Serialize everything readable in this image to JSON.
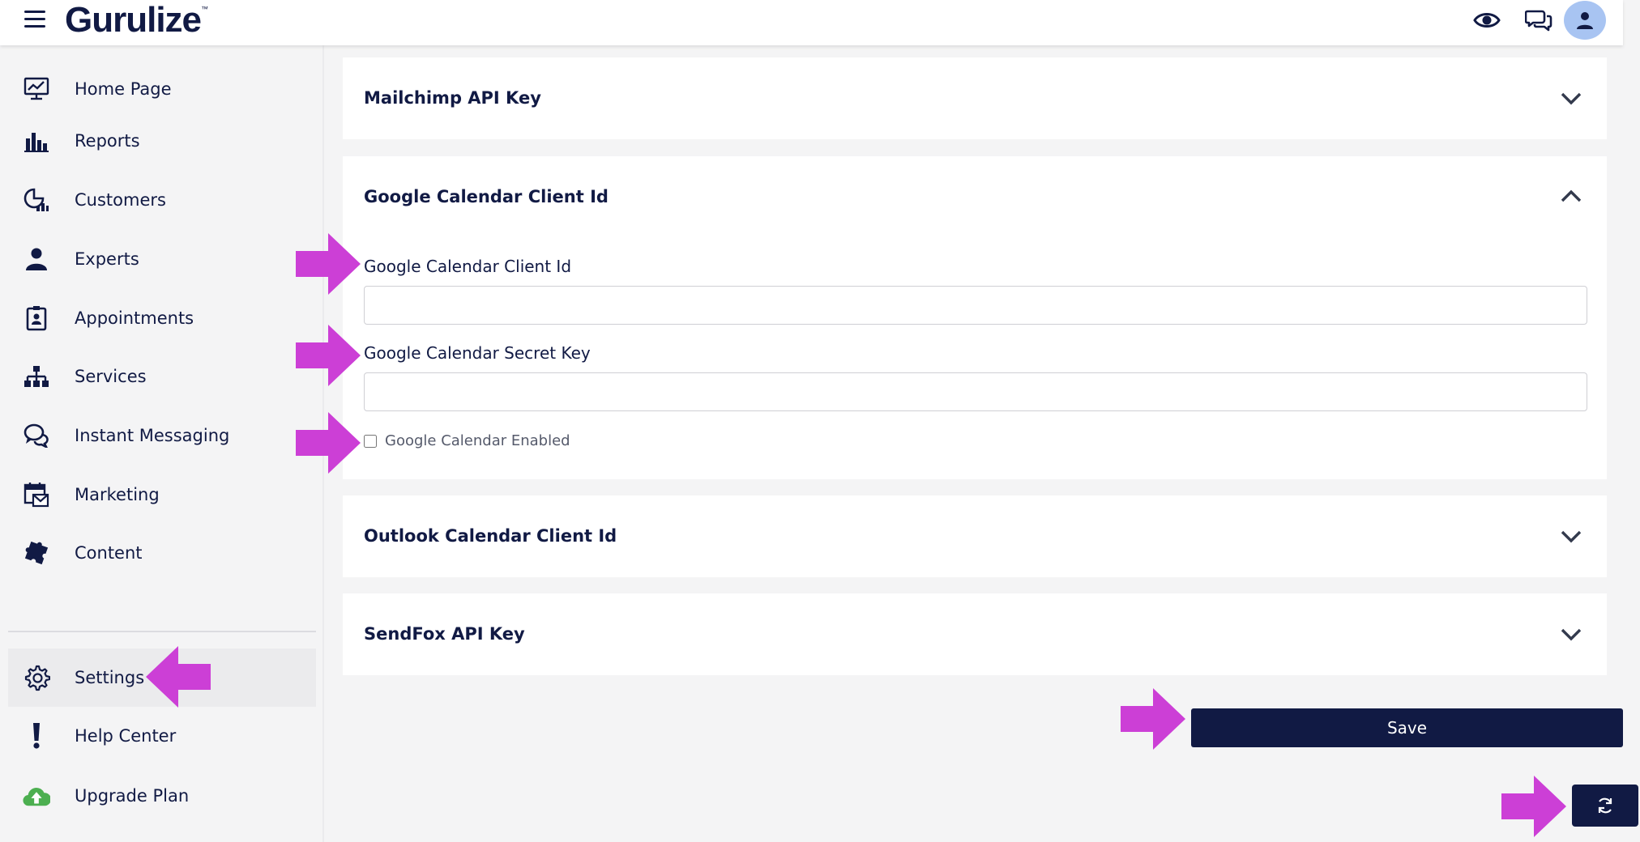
{
  "app": {
    "logo_text": "Gurulize",
    "logo_mark": "™"
  },
  "header": {
    "icons": [
      "menu-icon",
      "eye-icon",
      "chat-icon",
      "user-icon"
    ]
  },
  "sidebar": {
    "items": [
      {
        "label": "Home Page",
        "icon": "monitor-chart-icon"
      },
      {
        "label": "Reports",
        "icon": "bar-chart-icon"
      },
      {
        "label": "Customers",
        "icon": "pie-chart-icon"
      },
      {
        "label": "Experts",
        "icon": "person-icon"
      },
      {
        "label": "Appointments",
        "icon": "badge-icon"
      },
      {
        "label": "Services",
        "icon": "sitemap-icon"
      },
      {
        "label": "Instant Messaging",
        "icon": "chat-bubbles-icon"
      },
      {
        "label": "Marketing",
        "icon": "calendar-mail-icon"
      },
      {
        "label": "Content",
        "icon": "puzzle-icon"
      }
    ],
    "bottom_items": [
      {
        "label": "Settings",
        "icon": "gear-icon",
        "active": true
      },
      {
        "label": "Help Center",
        "icon": "exclamation-icon"
      },
      {
        "label": "Upgrade Plan",
        "icon": "cloud-upload-icon"
      }
    ]
  },
  "main": {
    "panels": [
      {
        "title": "Mailchimp API Key",
        "expanded": false
      },
      {
        "title": "Google Calendar Client Id",
        "expanded": true
      },
      {
        "title": "Outlook Calendar Client Id",
        "expanded": false
      },
      {
        "title": "SendFox API Key",
        "expanded": false
      }
    ],
    "google_calendar": {
      "client_id_label": "Google Calendar Client Id",
      "client_id_value": "",
      "secret_key_label": "Google Calendar Secret Key",
      "secret_key_value": "",
      "enabled_label": "Google Calendar Enabled",
      "enabled": false
    },
    "save_label": "Save",
    "refresh_icon": "refresh-icon"
  },
  "annotations": {
    "arrow_color": "#cc3fd6"
  },
  "colors": {
    "navy": "#111a44",
    "background": "#f4f4f5",
    "avatar": "#a8c4f2",
    "upgrade_green": "#4caf50"
  }
}
